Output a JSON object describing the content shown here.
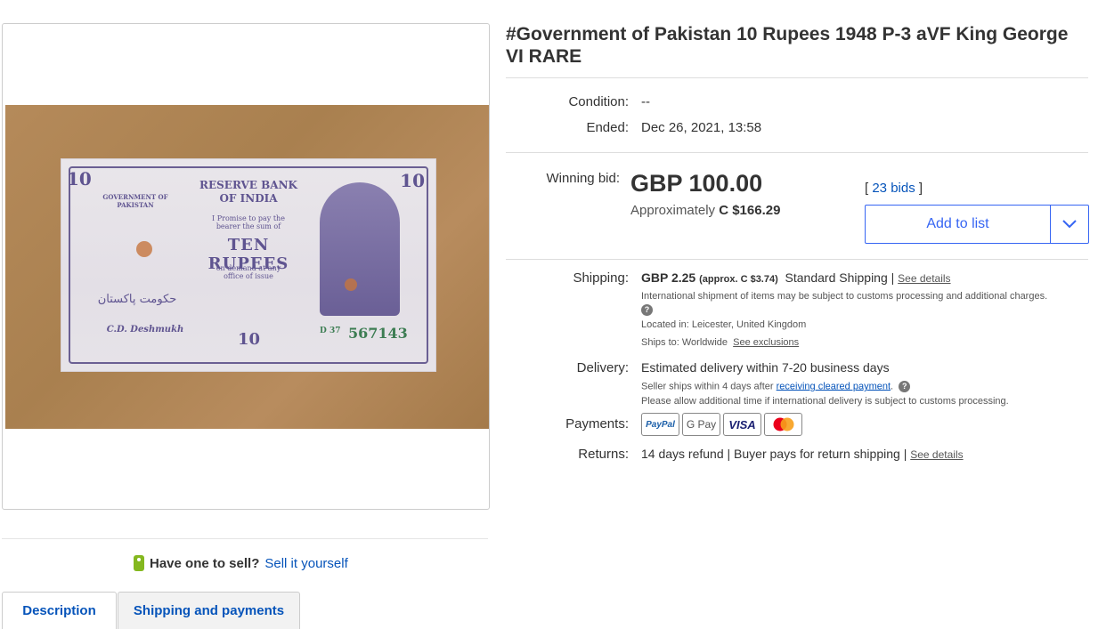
{
  "product": {
    "title": "#Government of Pakistan 10 Rupees 1948 P-3 aVF King George VI RARE"
  },
  "note_art": {
    "bank_line1": "RESERVE BANK",
    "bank_line2": "OF INDIA",
    "govt": "GOVERNMENT OF PAKISTAN",
    "promise": "I Promise to pay the bearer the sum of",
    "denomination": "TEN RUPEES",
    "on_demand": "on demand at any office of issue",
    "corner": "10",
    "serial": "567143",
    "prefix": "D 37",
    "signature": "C.D. Deshmukh",
    "urdu": "حکومت پاکستان"
  },
  "details": {
    "condition_label": "Condition:",
    "condition_value": "--",
    "ended_label": "Ended:",
    "ended_value": "Dec 26, 2021, 13:58",
    "winning_bid_label": "Winning bid:",
    "price": "GBP 100.00",
    "approx_prefix": "Approximately",
    "approx_value": "C $166.29",
    "bids_open": "[",
    "bids_link": "23 bids",
    "bids_close": "]",
    "add_to_list": "Add to list"
  },
  "shipping": {
    "label": "Shipping:",
    "cost": "GBP 2.25",
    "approx": "(approx. C $3.74)",
    "method": "Standard Shipping",
    "separator": "|",
    "see_details": "See details",
    "intl_note": "International shipment of items may be subject to customs processing and additional charges.",
    "located_label": "Located in:",
    "located_value": "Leicester, United Kingdom",
    "ships_label": "Ships to:",
    "ships_value": "Worldwide",
    "see_exclusions": "See exclusions"
  },
  "delivery": {
    "label": "Delivery:",
    "estimate": "Estimated delivery within 7-20 business days",
    "seller_ships_prefix": "Seller ships within 4 days after",
    "seller_ships_link": "receiving cleared payment",
    "seller_ships_suffix": ".",
    "allow_note": "Please allow additional time if international delivery is subject to customs processing."
  },
  "payments": {
    "label": "Payments:",
    "methods": [
      "PayPal",
      "G Pay",
      "VISA",
      "Mastercard"
    ]
  },
  "returns": {
    "label": "Returns:",
    "value": "14 days refund | Buyer pays for return shipping",
    "separator": "|",
    "see_details": "See details"
  },
  "sell": {
    "question": "Have one to sell?",
    "link": "Sell it yourself"
  },
  "tabs": {
    "description": "Description",
    "shipping": "Shipping and payments"
  },
  "colors": {
    "link": "#0654ba",
    "button_blue": "#3665f3",
    "tag_green": "#84b81f"
  }
}
